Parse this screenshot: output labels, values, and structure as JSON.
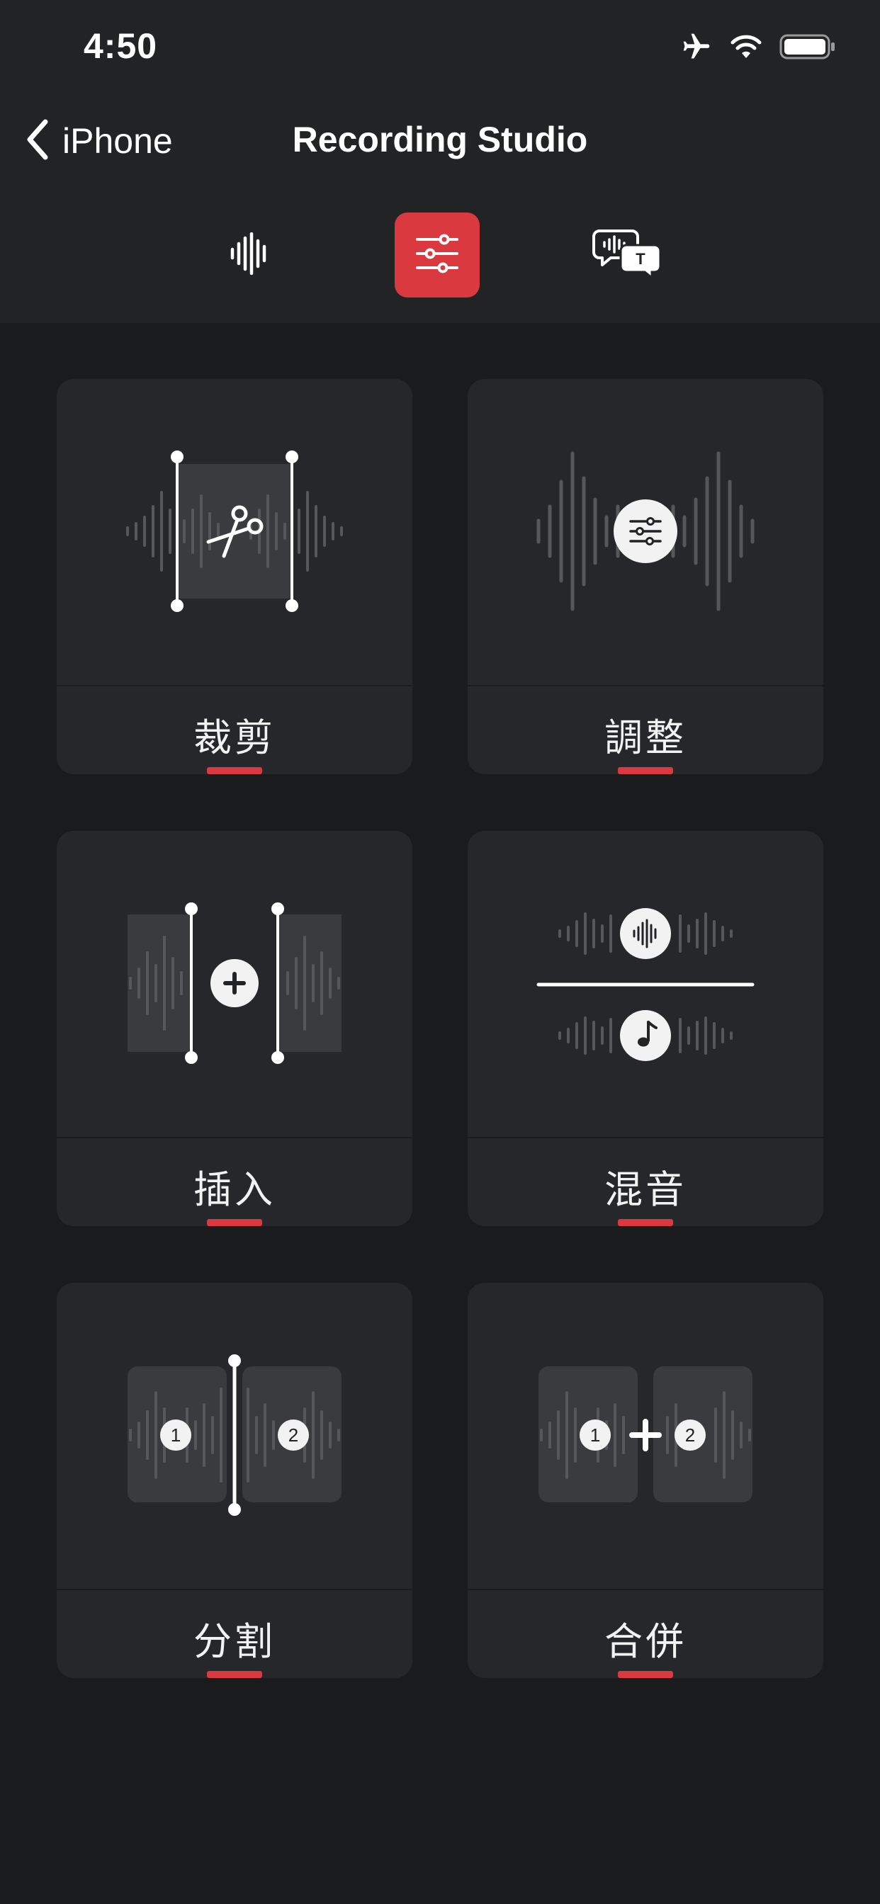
{
  "status_bar": {
    "time": "4:50",
    "icons": [
      "airplane-icon",
      "wifi-icon",
      "battery-icon"
    ]
  },
  "nav": {
    "back_label": "iPhone",
    "title": "Recording Studio"
  },
  "tabs": [
    {
      "icon": "waveform-icon",
      "active": false
    },
    {
      "icon": "sliders-icon",
      "active": true
    },
    {
      "icon": "speech-to-text-icon",
      "active": false
    }
  ],
  "cards": [
    {
      "label": "裁剪",
      "icon": "trim-icon"
    },
    {
      "label": "調整",
      "icon": "adjust-icon"
    },
    {
      "label": "插入",
      "icon": "insert-icon"
    },
    {
      "label": "混音",
      "icon": "mix-icon"
    },
    {
      "label": "分割",
      "icon": "split-icon"
    },
    {
      "label": "合併",
      "icon": "merge-icon"
    }
  ],
  "colors": {
    "accent": "#d9393f",
    "background": "#1a1b1d",
    "header": "#222325",
    "card": "#26272a"
  }
}
